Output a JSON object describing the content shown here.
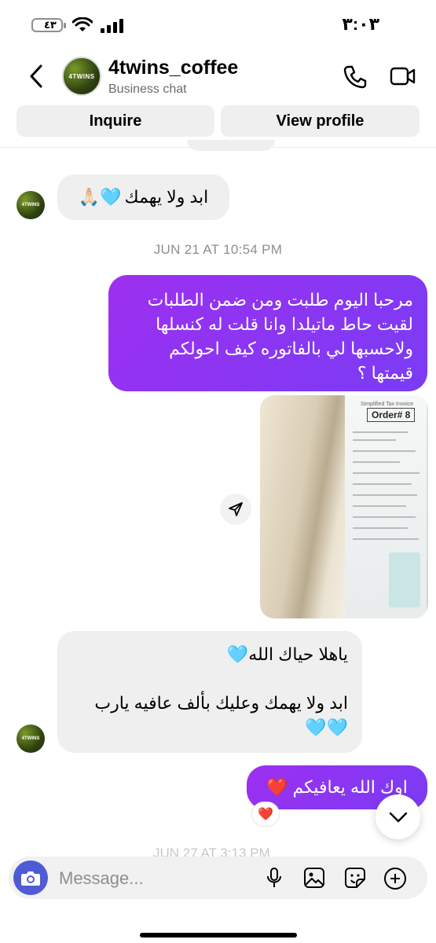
{
  "status_bar": {
    "time": "٣:٠٣",
    "battery": "٤٣"
  },
  "header": {
    "title": "4twins_coffee",
    "subtitle": "Business chat",
    "avatar_text": "4TWINS"
  },
  "actions": {
    "inquire": "Inquire",
    "view_profile": "View profile"
  },
  "messages": {
    "m1": {
      "text": "ابد ولا يهمك",
      "emoji": "🩵🙏🏻"
    },
    "timestamp": "JUN 21 AT 10:54 PM",
    "m2": {
      "text": "مرحبا اليوم طلبت ومن ضمن الطلبات لقيت حاط ماتيلدا وانا قلت له كنسلها ولاحسبها لي بالفاتوره كيف احولكم قيمتها ؟"
    },
    "photo": {
      "receipt_title": "Simplified Tax Invoice",
      "order": "Order# 8"
    },
    "m3": {
      "line1": "ياهلا حياك الله",
      "line1_emoji": "🩵",
      "line2": "ابد ولا يهمك وعليك بألف عافيه يارب",
      "line2_emoji": "🩵🩵"
    },
    "m4": {
      "text": "اوك الله يعافيكم",
      "emoji": "❤️"
    },
    "reaction": "❤️",
    "next_timestamp": "JUN 27 AT 3:13 PM"
  },
  "composer": {
    "placeholder": "Message..."
  },
  "icons": [
    "back-icon",
    "phone-icon",
    "video-icon",
    "share-icon",
    "chevron-down-icon",
    "camera-icon",
    "microphone-icon",
    "gallery-icon",
    "sticker-icon",
    "plus-icon"
  ],
  "colors": {
    "outgoing_bubble": "#8a34f2",
    "incoming_bubble": "#efefef",
    "camera_button": "#4f5bd5"
  }
}
